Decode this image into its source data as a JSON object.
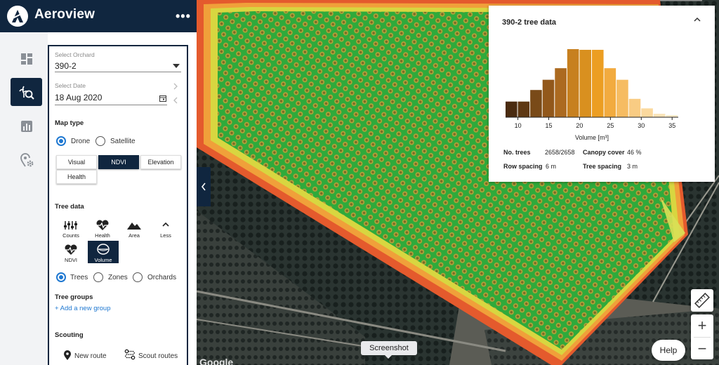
{
  "app": {
    "title": "Aeroview",
    "more": "•••"
  },
  "rail": {
    "items": [
      {
        "name": "dashboard",
        "icon": "dashboard-icon",
        "active": false
      },
      {
        "name": "crop-analysis",
        "icon": "crop-search-icon",
        "active": true
      },
      {
        "name": "reports",
        "icon": "bar-chart-icon",
        "active": false
      },
      {
        "name": "location-settings",
        "icon": "location-gear-icon",
        "active": false
      }
    ]
  },
  "panel": {
    "orchard": {
      "label": "Select Orchard",
      "value": "390-2"
    },
    "date": {
      "label": "Select Date",
      "value": "18 Aug 2020"
    },
    "map_type": {
      "heading": "Map type",
      "source": [
        {
          "label": "Drone",
          "selected": true
        },
        {
          "label": "Satellite",
          "selected": false
        }
      ],
      "layers": [
        {
          "label": "Visual",
          "selected": false
        },
        {
          "label": "NDVI",
          "selected": true
        },
        {
          "label": "Elevation",
          "selected": false
        },
        {
          "label": "Health",
          "selected": false
        }
      ]
    },
    "tree_data": {
      "heading": "Tree data",
      "metrics": [
        {
          "label": "Counts",
          "selected": false
        },
        {
          "label": "Health",
          "selected": false
        },
        {
          "label": "Area",
          "selected": false
        },
        {
          "label": "Less",
          "selected": false
        },
        {
          "label": "NDVI",
          "selected": false
        },
        {
          "label": "Volume",
          "selected": true
        }
      ],
      "scope": [
        {
          "label": "Trees",
          "selected": true
        },
        {
          "label": "Zones",
          "selected": false
        },
        {
          "label": "Orchards",
          "selected": false
        }
      ]
    },
    "tree_groups": {
      "heading": "Tree groups",
      "add": "+ Add a new group"
    },
    "scouting": {
      "heading": "Scouting",
      "new_route": "New route",
      "scout_routes": "Scout routes"
    }
  },
  "card": {
    "title": "390-2 tree data",
    "stats": {
      "no_trees_label": "No. trees",
      "no_trees_value": "2658/2658",
      "canopy_label": "Canopy cover",
      "canopy_value": "46 %",
      "row_label": "Row spacing",
      "row_value": "6 m",
      "tree_label": "Tree spacing",
      "tree_value": "3 m"
    }
  },
  "chart_data": {
    "type": "bar",
    "title": "",
    "xlabel": "Volume [m³]",
    "ylabel": "",
    "bin_start": 8,
    "bin_width": 2,
    "values": [
      23,
      23,
      40,
      55,
      72,
      100,
      99,
      99,
      72,
      55,
      27,
      13,
      5,
      3
    ],
    "colors": [
      "#4a2b10",
      "#5e3813",
      "#794a18",
      "#92581b",
      "#ac6a20",
      "#c7801f",
      "#d9901f",
      "#ec9e22",
      "#f2ab3f",
      "#f6bc62",
      "#f9cc83",
      "#fbd99e",
      "#fce4b8",
      "#fdecc9"
    ],
    "xticks": [
      10,
      15,
      20,
      25,
      30,
      35
    ],
    "xlim": [
      8,
      36
    ],
    "ylim": [
      0,
      100
    ],
    "grid": false,
    "legend": "none"
  },
  "map": {
    "help": "Help",
    "tooltip": "Screenshot",
    "attribution": "Google",
    "zoom_in": "+",
    "zoom_out": "−"
  }
}
